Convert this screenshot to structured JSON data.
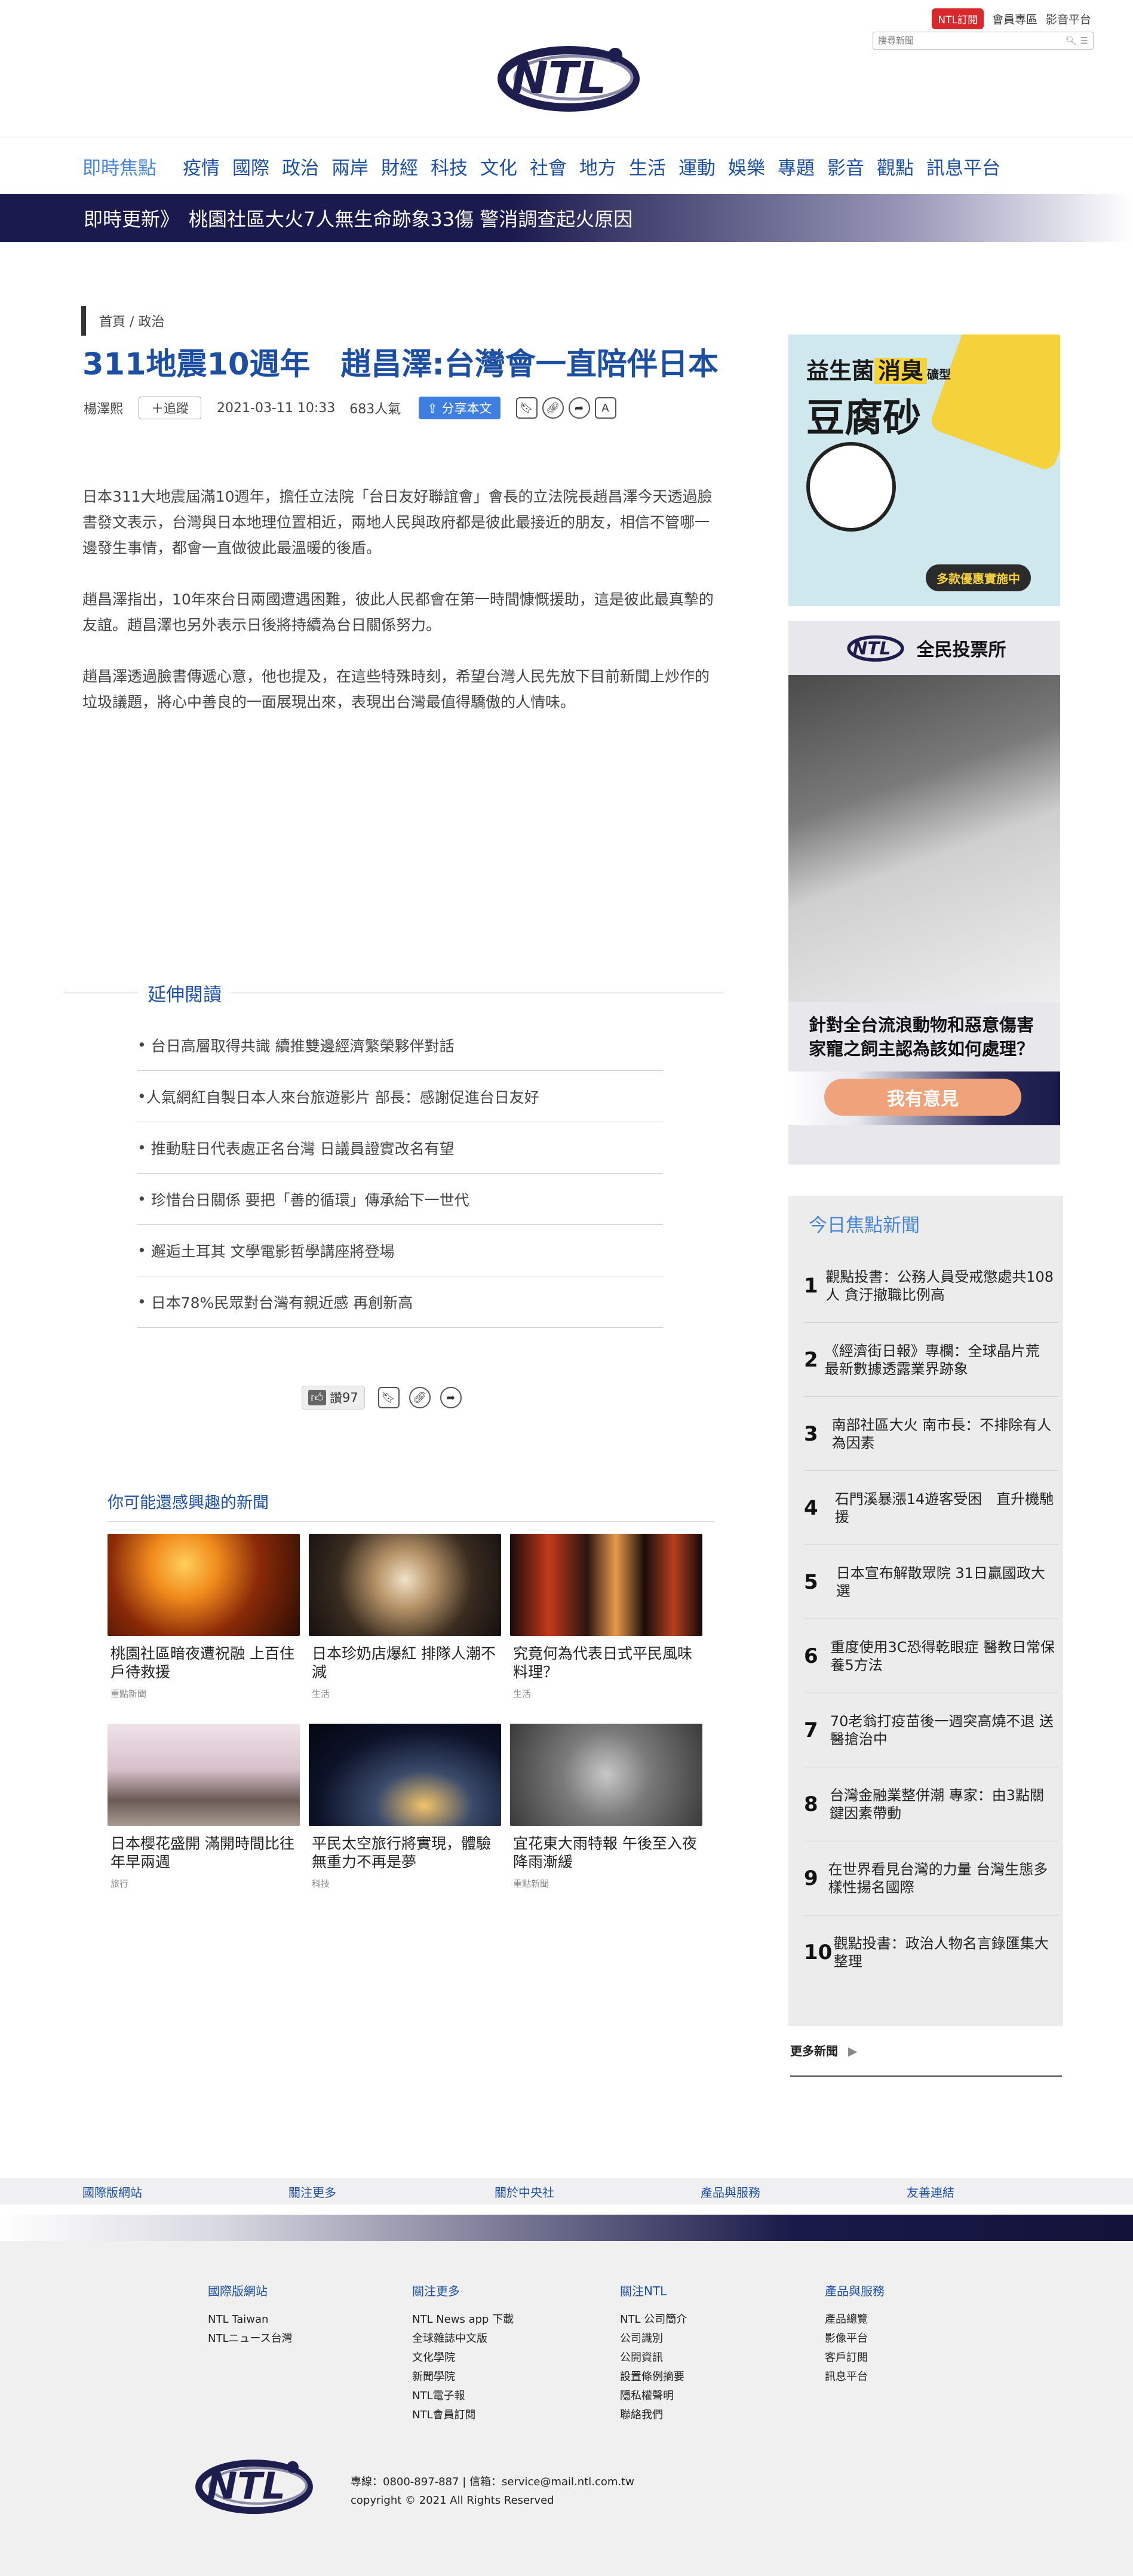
{
  "header": {
    "subscribe": "NTL訂閱",
    "member": "會員專區",
    "media": "影音平台",
    "search_placeholder": "搜尋新聞",
    "logo_text": "NTL"
  },
  "nav": {
    "hot": "即時焦點",
    "items": [
      "疫情",
      "國際",
      "政治",
      "兩岸",
      "財經",
      "科技",
      "文化",
      "社會",
      "地方",
      "生活",
      "運動",
      "娛樂",
      "專題",
      "影音",
      "觀點",
      "訊息平台"
    ]
  },
  "breaking": {
    "label": "即時更新》",
    "text": "桃園社區大火7人無生命跡象33傷 警消調查起火原因"
  },
  "article": {
    "breadcrumb": "首頁 / 政治",
    "title": "311地震10週年　趙昌澤:台灣會一直陪伴日本",
    "author": "楊澤熙",
    "follow": "＋追蹤",
    "date": "2021-03-11 10:33",
    "views": "683人氣",
    "share": "分享本文",
    "paragraphs": [
      "日本311大地震屆滿10週年，擔任立法院「台日友好聯誼會」會長的立法院長趙昌澤今天透過臉書發文表示，台灣與日本地理位置相近，兩地人民與政府都是彼此最接近的朋友，相信不管哪一邊發生事情，都會一直做彼此最溫暖的後盾。",
      "趙昌澤指出，10年來台日兩國遭遇困難，彼此人民都會在第一時間慷慨援助，這是彼此最真摯的友誼。趙昌澤也另外表示日後將持續為台日關係努力。",
      "趙昌澤透過臉書傳遞心意，他也提及，在這些特殊時刻，希望台灣人民先放下目前新聞上炒作的垃圾議題，將心中善良的一面展現出來，表現出台灣最值得驕傲的人情味。"
    ]
  },
  "extend": {
    "title": "延伸閱讀",
    "items": [
      "台日高層取得共識 續推雙邊經濟繁榮夥伴對話",
      "人氣網紅自製日本人來台旅遊影片 部長：感謝促進台日友好",
      "推動駐日代表處正名台灣 日議員證實改名有望",
      "珍惜台日關係 要把「善的循環」傳承給下一世代",
      "邂逅土耳其 文學電影哲學講座將登場",
      "日本78%民眾對台灣有親近感 再創新高"
    ]
  },
  "actions": {
    "like": "讚",
    "like_count": "97"
  },
  "maylike": {
    "title": "你可能還感興趣的新聞",
    "cards": [
      {
        "title": "桃園社區暗夜遭祝融 上百住戶待救援",
        "cat": "重點新聞",
        "img": "fire"
      },
      {
        "title": "日本珍奶店爆紅 排隊人潮不減",
        "cat": "生活",
        "img": "boba"
      },
      {
        "title": "究竟何為代表日式平民風味料理？",
        "cat": "生活",
        "img": "alley"
      },
      {
        "title": "日本櫻花盛開 滿開時間比往年早兩週",
        "cat": "旅行",
        "img": "sakura"
      },
      {
        "title": "平民太空旅行將實現，體驗無重力不再是夢",
        "cat": "科技",
        "img": "earth"
      },
      {
        "title": "宜花東大雨特報 午後至入夜降雨漸緩",
        "cat": "重點新聞",
        "img": "rain"
      }
    ]
  },
  "ad": {
    "line1": "益生菌",
    "hl": "消臭",
    "line2": "豆腐砂",
    "small": "礦型",
    "btn": "多款優惠實施中"
  },
  "poll": {
    "title": "全民投票所",
    "question": "針對全台流浪動物和惡意傷害家寵之飼主認為該如何處理？",
    "btn": "我有意見"
  },
  "focus": {
    "title": "今日焦點新聞",
    "items": [
      "觀點投書：公務人員受戒懲處共108人 貪汙撤職比例高",
      "《經濟街日報》專欄：全球晶片荒 最新數據透露業界跡象",
      "南部社區大火 南市長：不排除有人為因素",
      "石門溪暴漲14遊客受困　直升機馳援",
      "日本宣布解散眾院 31日贏國政大選",
      "重度使用3C恐得乾眼症 醫教日常保養5方法",
      "70老翁打疫苗後一週突高燒不退 送醫搶治中",
      "台灣金融業整併潮 專家：由3點關鍵因素帶動",
      "在世界看見台灣的力量 台灣生態多樣性揚名國際",
      "觀點投書：政治人物名言錄匯集大整理"
    ],
    "more": "更多新聞"
  },
  "footer": {
    "links": [
      "國際版網站",
      "關注更多",
      "關於中央社",
      "產品與服務",
      "友善連結"
    ],
    "col1": {
      "title": "國際版網站",
      "items": [
        "NTL Taiwan",
        "NTLニュース台灣"
      ]
    },
    "col2": {
      "title": "關注更多",
      "items": [
        "NTL News app 下載",
        "全球雜誌中文版",
        "文化學院",
        "新聞學院",
        "NTL電子報",
        "NTL會員訂閱"
      ]
    },
    "col3": {
      "title": "關注NTL",
      "items": [
        "NTL 公司簡介",
        "公司識別",
        "公開資訊",
        "設置條例摘要",
        "隱私權聲明",
        "聯絡我們"
      ]
    },
    "col4": {
      "title": "產品與服務",
      "items": [
        "產品總覽",
        "影像平台",
        "客戶訂閱",
        "訊息平台"
      ]
    },
    "contact": "專線：0800-897-887 | 信箱：service@mail.ntl.com.tw",
    "copyright": "copyright © 2021 All Rights Reserved"
  }
}
